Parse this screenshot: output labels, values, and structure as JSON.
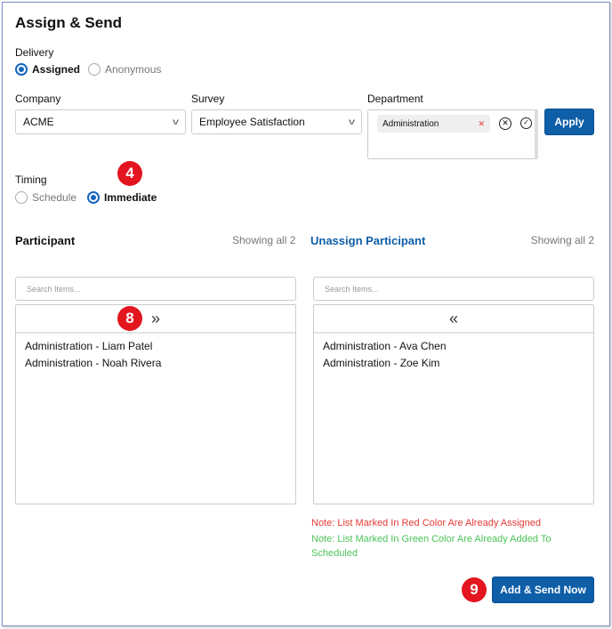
{
  "title": "Assign & Send",
  "delivery": {
    "label": "Delivery",
    "options": [
      {
        "label": "Assigned",
        "selected": true
      },
      {
        "label": "Anonymous",
        "selected": false
      }
    ]
  },
  "company": {
    "label": "Company",
    "value": "ACME"
  },
  "survey": {
    "label": "Survey",
    "value": "Employee Satisfaction"
  },
  "department": {
    "label": "Department",
    "tags": [
      "Administration"
    ]
  },
  "apply_label": "Apply",
  "timing": {
    "label": "Timing",
    "options": [
      {
        "label": "Schedule",
        "selected": false
      },
      {
        "label": "Immediate",
        "selected": true
      }
    ]
  },
  "badges": [
    "4",
    "8",
    "9"
  ],
  "participant": {
    "title": "Participant",
    "count": "Showing all 2",
    "search_placeholder": "Search Items...",
    "move_icon": "»",
    "items": [
      "Administration - Liam Patel",
      "Administration - Noah Rivera"
    ]
  },
  "unassign": {
    "title": "Unassign Participant",
    "count": "Showing all 2",
    "search_placeholder": "Search Items...",
    "move_icon": "«",
    "items": [
      "Administration - Ava Chen",
      "Administration - Zoe Kim"
    ]
  },
  "notes": {
    "red": "Note: List Marked In Red Color Are Already Assigned",
    "green": "Note: List Marked In Green Color Are Already Added To Scheduled"
  },
  "submit_label": "Add & Send Now",
  "colors": {
    "accent": "#0e5ea8",
    "badge": "#e3151f",
    "red_note": "#e53935",
    "green_note": "#4cc35a"
  }
}
